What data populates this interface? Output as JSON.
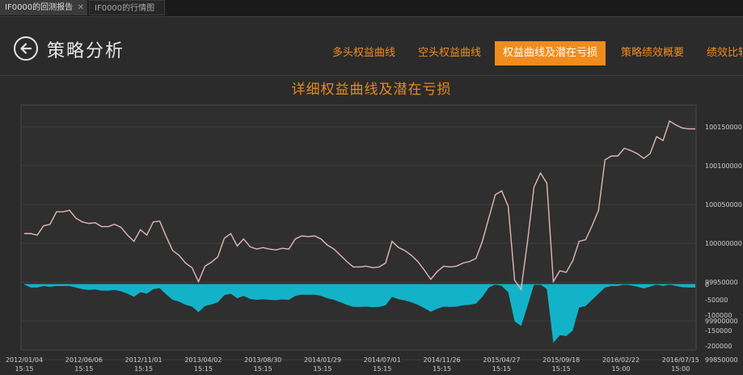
{
  "tabs": [
    {
      "label": "IF0000的回测报告",
      "active": true
    },
    {
      "label": "IF0000的行情图",
      "active": false
    }
  ],
  "header": {
    "title": "策略分析"
  },
  "nav": [
    {
      "label": "多头权益曲线"
    },
    {
      "label": "空头权益曲线"
    },
    {
      "label": "权益曲线及潜在亏损",
      "active": true
    },
    {
      "label": "策略绩效概要"
    },
    {
      "label": "绩效比较"
    }
  ],
  "colors": {
    "accent": "#f08c1e",
    "equity_line": "#e3b7b7",
    "drawdown_fill": "#12b3c9"
  },
  "chart_data": [
    {
      "type": "line",
      "title": "详细权益曲线及潜在亏损",
      "x_ticks": [
        [
          "2012/01/04",
          "15:15"
        ],
        [
          "2012/06/06",
          "15:15"
        ],
        [
          "2012/11/01",
          "15:15"
        ],
        [
          "2013/04/02",
          "15:15"
        ],
        [
          "2013/08/30",
          "15:15"
        ],
        [
          "2014/01/29",
          "15:15"
        ],
        [
          "2014/07/01",
          "15:15"
        ],
        [
          "2014/11/26",
          "15:15"
        ],
        [
          "2015/04/27",
          "15:15"
        ],
        [
          "2015/09/18",
          "15:15"
        ],
        [
          "2016/02/22",
          "15:00"
        ],
        [
          "2016/07/15",
          "15:00"
        ]
      ],
      "y_ticks": [
        "100150000",
        "100100000",
        "100050000",
        "100000000",
        "99950000",
        "99900000",
        "99850000"
      ],
      "ylim": [
        99850000,
        100150000
      ],
      "series": [
        {
          "values": [
            100000000,
            100000000,
            99998000,
            100010000,
            100012000,
            100028000,
            100028000,
            100030000,
            100020000,
            100015000,
            100013000,
            100014000,
            100009000,
            100009000,
            100012000,
            100008000,
            99998000,
            99990000,
            100005000,
            99998000,
            100015000,
            100016000,
            99996000,
            99978000,
            99972000,
            99962000,
            99956000,
            99938000,
            99958000,
            99963000,
            99970000,
            99994000,
            100000000,
            99984000,
            99993000,
            99983000,
            99980000,
            99982000,
            99980000,
            99979000,
            99981000,
            99980000,
            99993000,
            99997000,
            99996000,
            99997000,
            99993000,
            99985000,
            99980000,
            99972000,
            99964000,
            99957000,
            99957000,
            99958000,
            99956000,
            99957000,
            99962000,
            99990000,
            99982000,
            99978000,
            99972000,
            99964000,
            99953000,
            99941000,
            99951000,
            99958000,
            99957000,
            99958000,
            99962000,
            99964000,
            99968000,
            99990000,
            100020000,
            100050000,
            100055000,
            100035000,
            99940000,
            99928000,
            99990000,
            100060000,
            100078000,
            100065000,
            99938000,
            99952000,
            99950000,
            99965000,
            99990000,
            99992000,
            100010000,
            100030000,
            100095000,
            100100000,
            100100000,
            100110000,
            100107000,
            100103000,
            100097000,
            100103000,
            100125000,
            100120000,
            100145000,
            100140000,
            100136000,
            100135000,
            100135000
          ]
        }
      ]
    },
    {
      "type": "area",
      "y_ticks": [
        "0",
        "-50000",
        "-100000",
        "-150000",
        "-200000"
      ],
      "ylim": [
        -200000,
        0
      ],
      "series": [
        {
          "values": [
            0,
            -10000,
            -10000,
            -5000,
            -8000,
            -5000,
            -5000,
            -5000,
            -10000,
            -15000,
            -18000,
            -16000,
            -20000,
            -20000,
            -18000,
            -22000,
            -30000,
            -40000,
            -25000,
            -30000,
            -15000,
            -12000,
            -32000,
            -50000,
            -56000,
            -66000,
            -72000,
            -90000,
            -70000,
            -65000,
            -58000,
            -35000,
            -30000,
            -45000,
            -37000,
            -47000,
            -50000,
            -48000,
            -50000,
            -51000,
            -49000,
            -50000,
            -37000,
            -33000,
            -34000,
            -33000,
            -37000,
            -45000,
            -50000,
            -58000,
            -66000,
            -73000,
            -73000,
            -72000,
            -74000,
            -73000,
            -68000,
            -40000,
            -48000,
            -52000,
            -58000,
            -66000,
            -77000,
            -89000,
            -79000,
            -72000,
            -73000,
            -72000,
            -68000,
            -66000,
            -62000,
            -40000,
            -10000,
            0,
            -5000,
            -25000,
            -120000,
            -135000,
            -70000,
            0,
            0,
            -15000,
            -190000,
            -165000,
            -168000,
            -150000,
            -75000,
            -70000,
            -50000,
            -30000,
            -10000,
            -5000,
            -5000,
            0,
            -3000,
            -7000,
            -13000,
            -7000,
            0,
            -5000,
            0,
            -5000,
            -9000,
            -10000,
            -10000
          ]
        }
      ]
    }
  ]
}
